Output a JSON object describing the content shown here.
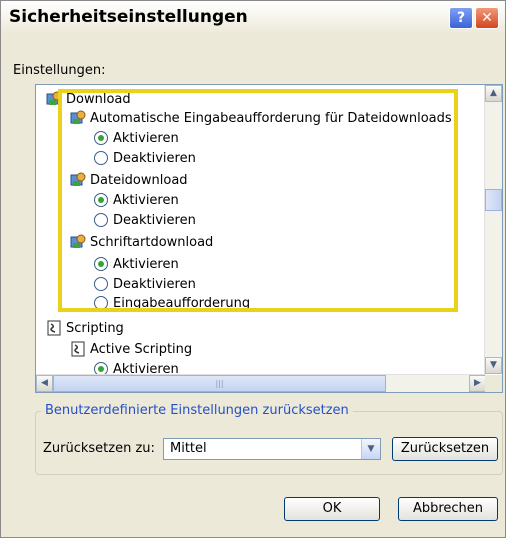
{
  "window": {
    "title": "Sicherheitseinstellungen",
    "help_glyph": "?",
    "close_glyph": "✕"
  },
  "settings_label": "Einstellungen:",
  "tree": {
    "download": "Download",
    "auto_prompt": "Automatische Eingabeaufforderung für Dateidownloads",
    "file_download": "Dateidownload",
    "font_download": "Schriftartdownload",
    "scripting": "Scripting",
    "active_scripting": "Active Scripting",
    "enable": "Aktivieren",
    "disable": "Deaktivieren",
    "prompt": "Eingabeaufforderung"
  },
  "reset_group": {
    "title": "Benutzerdefinierte Einstellungen zurücksetzen",
    "reset_to_label": "Zurücksetzen zu:",
    "selected_level": "Mittel",
    "reset_button": "Zurücksetzen"
  },
  "buttons": {
    "ok": "OK",
    "cancel": "Abbrechen"
  },
  "colors": {
    "highlight": "#e8d31a",
    "radio_selected": "#33a533",
    "group_title": "#2450c8"
  }
}
